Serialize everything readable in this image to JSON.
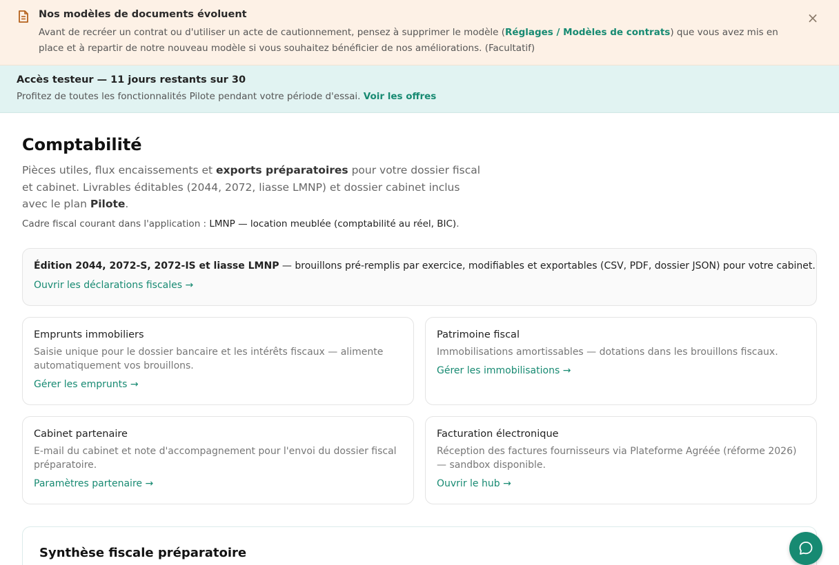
{
  "notice": {
    "title": "Nos modèles de documents évoluent",
    "body_before": "Avant de recréer un contrat ou d'utiliser un acte de cautionnement, pensez à supprimer le modèle (",
    "link": "Réglages / Modèles de contrats",
    "body_after": ") que vous avez mis en place et à repartir de notre nouveau modèle si vous souhaitez bénéficier de nos améliorations. (Facultatif)",
    "close": "×",
    "icon": "document-icon"
  },
  "trial": {
    "title": "Accès testeur — 11 jours restants sur 30",
    "body": "Profitez de toutes les fonctionnalités Pilote pendant votre période d'essai.",
    "link": "Voir les offres"
  },
  "page": {
    "title": "Comptabilité",
    "intro_1": "Pièces utiles, flux encaissements et",
    "intro_bold_1": "exports préparatoires",
    "intro_2": "pour votre dossier fiscal et cabinet. Livrables éditables (2044, 2072, liasse LMNP) et dossier cabinet inclus avec le plan",
    "intro_bold_2": "Pilote",
    "intro_end": ".",
    "fiscal_label": "Cadre fiscal courant dans l'application :",
    "fiscal_value": "LMNP — location meublée (comptabilité au réel, BIC)",
    "fiscal_end": "."
  },
  "declarations_card": {
    "title_bold": "Édition 2044, 2072-S, 2072-IS et liasse LMNP",
    "title_rest": "— brouillons pré-remplis par exercice, modifiables et exportables (CSV, PDF, dossier JSON) pour votre cabinet.",
    "link": "Ouvrir les déclarations fiscales →"
  },
  "cards": [
    {
      "title": "Emprunts immobiliers",
      "desc": "Saisie unique pour le dossier bancaire et les intérêts fiscaux — alimente automatiquement vos brouillons.",
      "link": "Gérer les emprunts →"
    },
    {
      "title": "Patrimoine fiscal",
      "desc": "Immobilisations amortissables — dotations dans les brouillons fiscaux.",
      "link": "Gérer les immobilisations →"
    },
    {
      "title": "Cabinet partenaire",
      "desc": "E-mail du cabinet et note d'accompagnement pour l'envoi du dossier fiscal préparatoire.",
      "link": "Paramètres partenaire →"
    },
    {
      "title": "Facturation électronique",
      "desc": "Réception des factures fournisseurs via Plateforme Agréée (réforme 2026) — sandbox disponible.",
      "link": "Ouvrir le hub →"
    }
  ],
  "summary": {
    "title": "Synthèse fiscale préparatoire"
  },
  "chat": {
    "icon": "chat-bubble-icon"
  },
  "colors": {
    "accent": "#178a72",
    "notice_bg": "#fdf1e6",
    "trial_bg": "#e1f3f2"
  }
}
